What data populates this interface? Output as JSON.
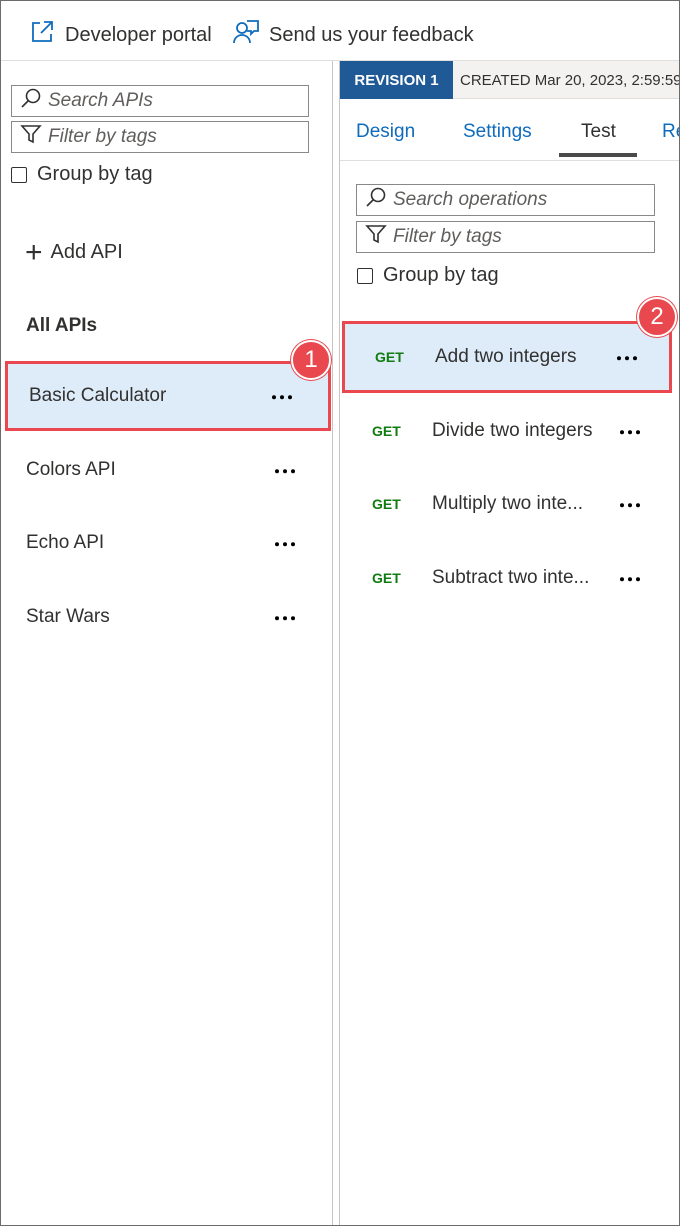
{
  "toolbar": {
    "developer_portal": "Developer portal",
    "feedback": "Send us your feedback"
  },
  "left": {
    "search_placeholder": "Search APIs",
    "filter_placeholder": "Filter by tags",
    "group_by_tag": "Group by tag",
    "add_api": "Add API",
    "section_heading": "All APIs",
    "apis": [
      {
        "label": "Basic Calculator",
        "selected": true
      },
      {
        "label": "Colors API"
      },
      {
        "label": "Echo API"
      },
      {
        "label": "Star Wars"
      }
    ]
  },
  "right": {
    "revision_badge": "REVISION 1",
    "created": "CREATED Mar 20, 2023, 2:59:59",
    "tabs": [
      {
        "label": "Design"
      },
      {
        "label": "Settings"
      },
      {
        "label": "Test",
        "active": true
      },
      {
        "label": "Re"
      }
    ],
    "search_placeholder": "Search operations",
    "filter_placeholder": "Filter by tags",
    "group_by_tag": "Group by tag",
    "operations": [
      {
        "method": "GET",
        "name": "Add two integers",
        "selected": true
      },
      {
        "method": "GET",
        "name": "Divide two integers"
      },
      {
        "method": "GET",
        "name": "Multiply two inte..."
      },
      {
        "method": "GET",
        "name": "Subtract two inte..."
      }
    ]
  },
  "callouts": [
    "1",
    "2"
  ],
  "colors": {
    "accent_blue": "#1f5a96",
    "link_blue": "#0f6cbd",
    "selection_bg": "#deecf9",
    "highlight_red": "#e8484e",
    "method_green": "#107c10"
  }
}
